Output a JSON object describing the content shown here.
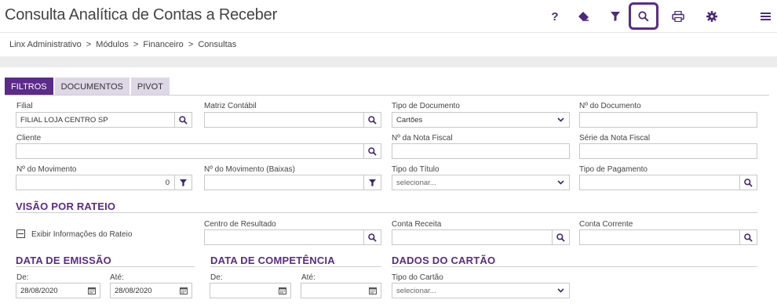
{
  "header": {
    "title": "Consulta Analítica de Contas a Receber",
    "icons": [
      "help-icon",
      "eraser-icon",
      "filter-icon",
      "search-icon",
      "print-icon",
      "gear-icon",
      "menu-icon"
    ],
    "help_glyph": "?"
  },
  "breadcrumb": [
    "Linx Administrativo",
    ">",
    "Módulos",
    ">",
    "Financeiro",
    ">",
    "Consultas"
  ],
  "tabs": [
    "FILTROS",
    "DOCUMENTOS",
    "PIVOT"
  ],
  "filters": {
    "filial_label": "Filial",
    "filial_value": "FILIAL LOJA CENTRO SP",
    "matriz_label": "Matriz Contábil",
    "tipo_doc_label": "Tipo de Documento",
    "tipo_doc_value": "Cartões",
    "num_doc_label": "Nº do Documento",
    "cliente_label": "Cliente",
    "nf_label": "Nº da Nota Fiscal",
    "serie_label": "Série da Nota Fiscal",
    "movimento_label": "Nº do Movimento",
    "movimento_value": "0",
    "movimento_baixas_label": "Nº do Movimento (Baixas)",
    "tipo_titulo_label": "Tipo do Título",
    "tipo_titulo_value": "selecionar...",
    "tipo_pag_label": "Tipo de Pagamento"
  },
  "rateio": {
    "section": "VISÃO POR RATEIO",
    "checkbox_label": "Exibir Informações do Rateio",
    "centro_label": "Centro de Resultado",
    "conta_receita_label": "Conta Receita",
    "conta_corrente_label": "Conta Corrente"
  },
  "emissao": {
    "section": "DATA DE EMISSÃO",
    "de_label": "De:",
    "de_value": "28/08/2020",
    "ate_label": "Até:",
    "ate_value": "28/08/2020"
  },
  "competencia": {
    "section": "DATA DE COMPETÊNCIA",
    "de_label": "De:",
    "ate_label": "Até:"
  },
  "cartao": {
    "section": "DADOS DO CARTÃO",
    "tipo_label": "Tipo do Cartão",
    "tipo_value": "selecionar..."
  },
  "colors": {
    "accent": "#5b2a8a",
    "tab_inactive": "#ddd7e6",
    "icon": "#3e2470"
  }
}
